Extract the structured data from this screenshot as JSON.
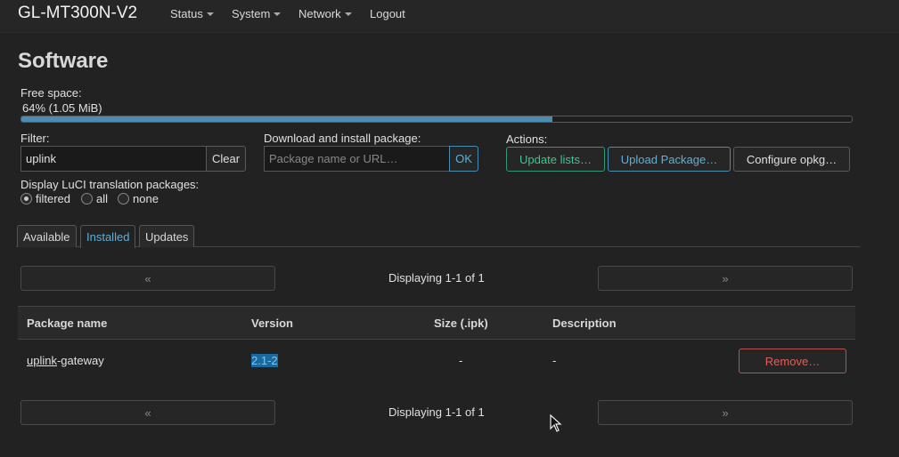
{
  "header": {
    "brand": "GL-MT300N-V2",
    "nav": [
      "Status",
      "System",
      "Network"
    ],
    "logout": "Logout"
  },
  "page": {
    "title": "Software",
    "free_space_label": "Free space:",
    "free_space_value": "64% (1.05 MiB)",
    "free_space_fraction": 0.64
  },
  "filter": {
    "label": "Filter:",
    "value": "uplink",
    "clear_label": "Clear"
  },
  "download": {
    "label": "Download and install package:",
    "placeholder": "Package name or URL…",
    "ok_label": "OK"
  },
  "actions": {
    "label": "Actions:",
    "update_lists": "Update lists…",
    "upload_package": "Upload Package…",
    "configure": "Configure opkg…"
  },
  "translation": {
    "label": "Display LuCI translation packages:",
    "options": [
      "filtered",
      "all",
      "none"
    ],
    "selected": "filtered"
  },
  "tabs": [
    "Available",
    "Installed",
    "Updates"
  ],
  "active_tab": "Installed",
  "pager": {
    "prev": "«",
    "next": "»",
    "text": "Displaying 1-1 of 1"
  },
  "table": {
    "headers": [
      "Package name",
      "Version",
      "Size (.ipk)",
      "Description"
    ],
    "rows": [
      {
        "name_match": "uplink",
        "name_rest": "-gateway",
        "version": "2.1-2",
        "size": "-",
        "description": "-",
        "action": "Remove…"
      }
    ]
  },
  "colors": {
    "accent_blue": "#5fb0d8",
    "accent_green": "#3fc58f",
    "danger": "#e0605c",
    "background": "#222222"
  }
}
